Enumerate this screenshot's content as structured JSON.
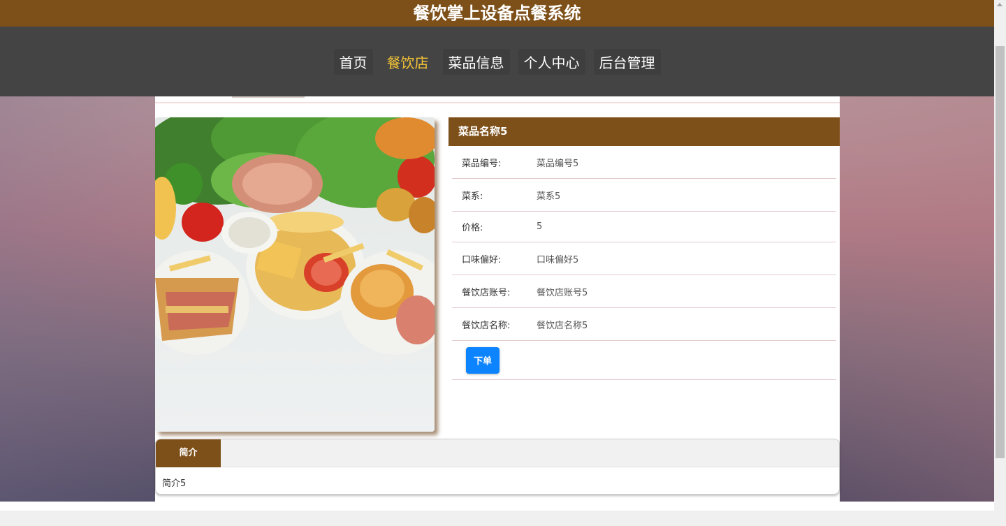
{
  "header": {
    "title": "餐饮掌上设备点餐系统"
  },
  "nav": {
    "items": [
      {
        "label": "首页",
        "active": false
      },
      {
        "label": "餐饮店",
        "active": true
      },
      {
        "label": "菜品信息",
        "active": false
      },
      {
        "label": "个人中心",
        "active": false
      },
      {
        "label": "后台管理",
        "active": false
      }
    ]
  },
  "dish": {
    "name": "菜品名称5",
    "fields": [
      {
        "label": "菜品编号:",
        "value": "菜品编号5"
      },
      {
        "label": "菜系:",
        "value": "菜系5"
      },
      {
        "label": "价格:",
        "value": "5"
      },
      {
        "label": "口味偏好:",
        "value": "口味偏好5"
      },
      {
        "label": "餐饮店账号:",
        "value": "餐饮店账号5"
      },
      {
        "label": "餐饮店名称:",
        "value": "餐饮店名称5"
      }
    ],
    "order_button": "下单"
  },
  "intro": {
    "tab_label": "简介",
    "text": "简介5"
  },
  "colors": {
    "brand": "#7e5019",
    "nav_bg": "#444444",
    "active_nav": "#f4c437",
    "button": "#0d84ff"
  },
  "image": {
    "icon": "food-photo"
  }
}
